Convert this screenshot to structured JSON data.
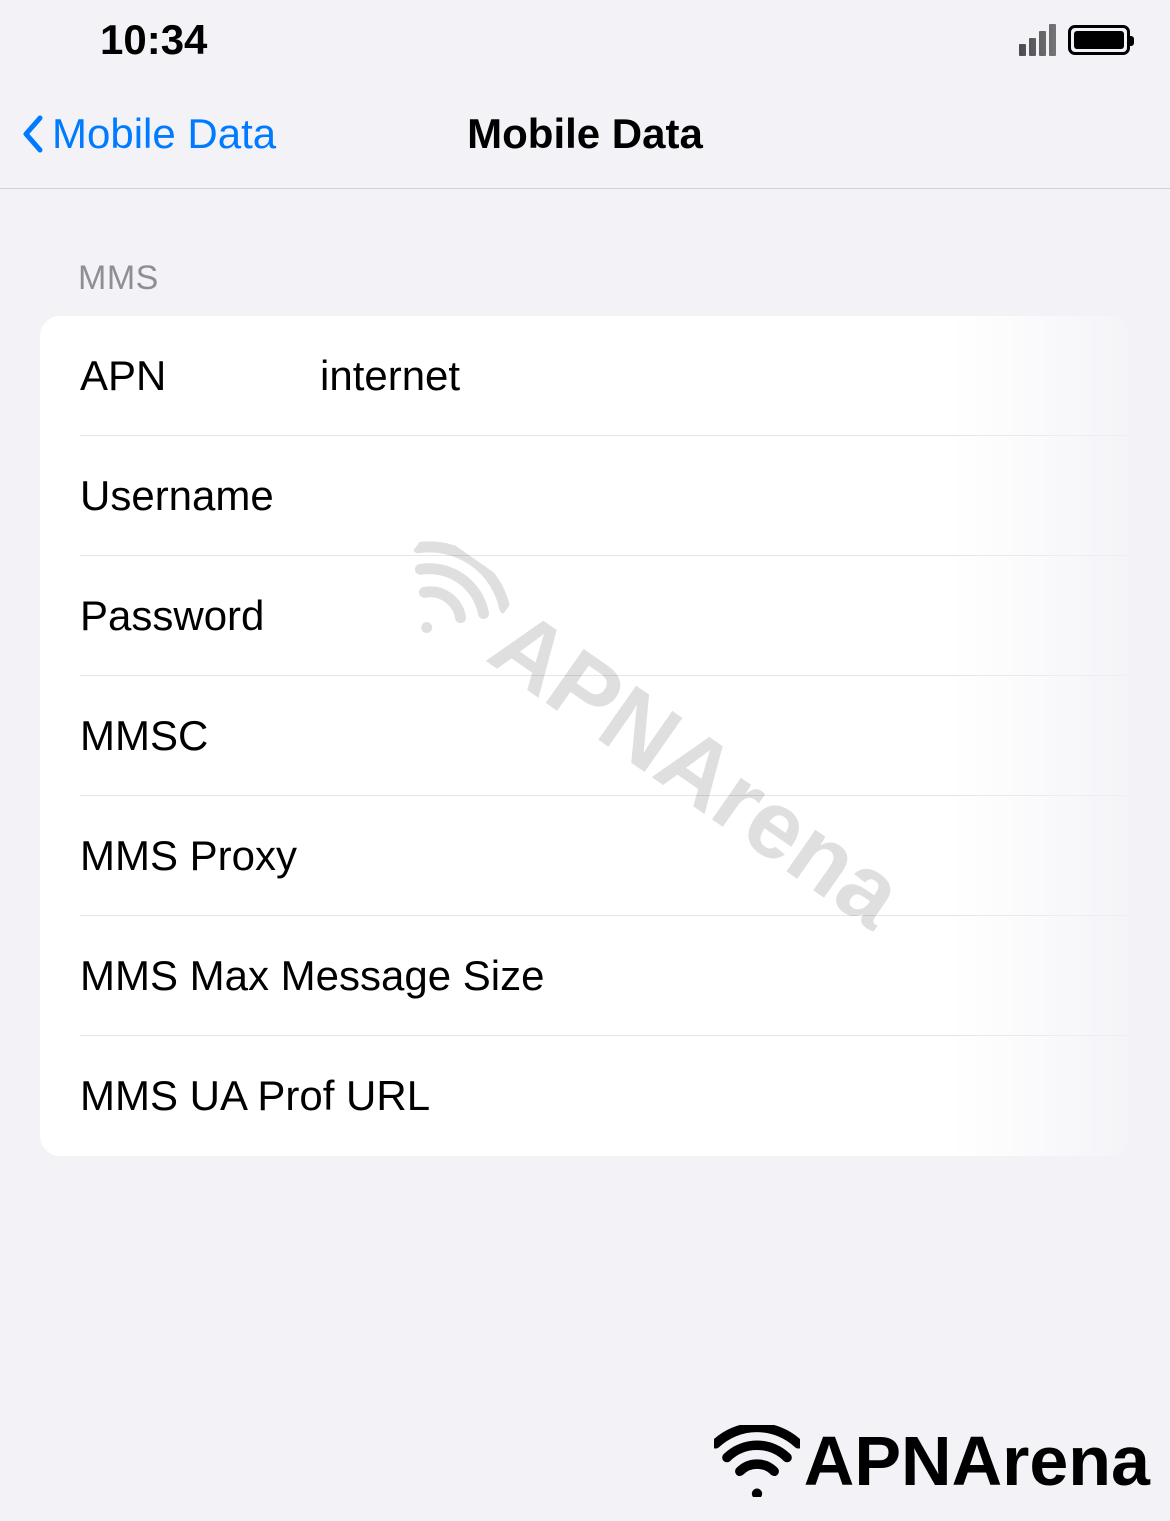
{
  "status_bar": {
    "time": "10:34"
  },
  "nav": {
    "back_label": "Mobile Data",
    "title": "Mobile Data"
  },
  "section": {
    "header": "MMS"
  },
  "fields": {
    "apn": {
      "label": "APN",
      "value": "internet"
    },
    "username": {
      "label": "Username",
      "value": ""
    },
    "password": {
      "label": "Password",
      "value": ""
    },
    "mmsc": {
      "label": "MMSC",
      "value": ""
    },
    "mms_proxy": {
      "label": "MMS Proxy",
      "value": ""
    },
    "mms_max_size": {
      "label": "MMS Max Message Size",
      "value": ""
    },
    "mms_ua_prof": {
      "label": "MMS UA Prof URL",
      "value": ""
    }
  },
  "watermark": {
    "text": "APNArena"
  },
  "logo": {
    "text": "APNArena"
  }
}
